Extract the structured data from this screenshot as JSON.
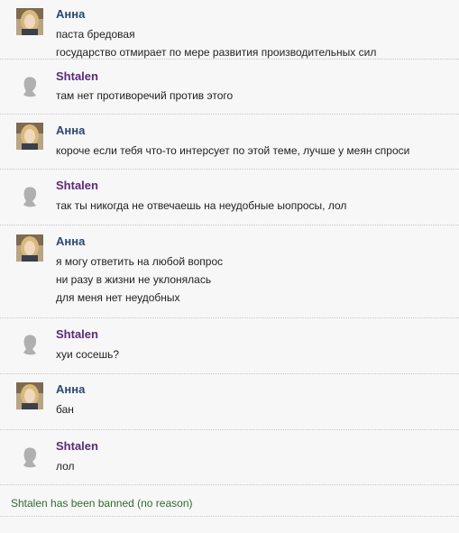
{
  "messages": [
    {
      "author": "Анна",
      "type": "anna",
      "lines": [
        "паста бредовая",
        "государство отмирает по мере развития производительных сил"
      ]
    },
    {
      "author": "Shtalen",
      "type": "shtalen",
      "lines": [
        "там нет противоречий против этого"
      ]
    },
    {
      "author": "Анна",
      "type": "anna",
      "lines": [
        "короче если тебя что-то интерсует по этой теме, лучше у меян спроси"
      ]
    },
    {
      "author": "Shtalen",
      "type": "shtalen",
      "lines": [
        "так ты никогда не отвечаешь на неудобные ыопросы, лол"
      ]
    },
    {
      "author": "Анна",
      "type": "anna",
      "lines": [
        "я могу ответить на любой вопрос",
        "ни разу в жизни не уклонялась",
        "для меня нет неудобных"
      ]
    },
    {
      "author": "Shtalen",
      "type": "shtalen",
      "lines": [
        "хуи сосешь?"
      ]
    },
    {
      "author": "Анна",
      "type": "anna",
      "lines": [
        "бан"
      ]
    },
    {
      "author": "Shtalen",
      "type": "shtalen",
      "lines": [
        "лол"
      ]
    }
  ],
  "system_message": "Shtalen has been banned (no reason)",
  "colors": {
    "anna_name": "#2a4870",
    "shtalen_name": "#5b2a78",
    "system_text": "#2f6b2f",
    "background": "#f7f7f7"
  },
  "icons": {
    "anna_avatar": "user-photo-avatar",
    "shtalen_avatar": "default-silhouette-avatar"
  }
}
